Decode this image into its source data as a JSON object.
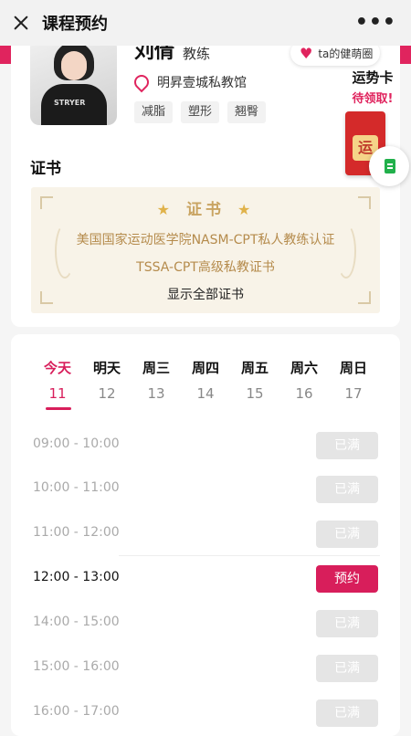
{
  "header": {
    "title": "课程预约",
    "more": "•••"
  },
  "coach": {
    "name": "刘倩",
    "role": "教练",
    "fan_circle": "ta的健萌圈",
    "location": "明昇壹城私教馆",
    "tags": [
      "减脂",
      "塑形",
      "翘臀"
    ]
  },
  "fortune_card": {
    "title": "运势卡",
    "subtitle": "待领取!",
    "char": "运"
  },
  "certificates": {
    "heading": "证书",
    "banner_title": "证书",
    "items": [
      "美国国家运动医学院NASM-CPT私人教练认证",
      "TSSA-CPT高级私教证书"
    ],
    "show_all": "显示全部证书"
  },
  "schedule": {
    "days": [
      {
        "name": "今天",
        "date": "11",
        "active": true
      },
      {
        "name": "明天",
        "date": "12"
      },
      {
        "name": "周三",
        "date": "13"
      },
      {
        "name": "周四",
        "date": "14"
      },
      {
        "name": "周五",
        "date": "15"
      },
      {
        "name": "周六",
        "date": "16"
      },
      {
        "name": "周日",
        "date": "17"
      }
    ],
    "slots": [
      {
        "time": "09:00 - 10:00",
        "status": "已满"
      },
      {
        "time": "10:00 - 11:00",
        "status": "已满"
      },
      {
        "time": "11:00 - 12:00",
        "status": "已满"
      },
      {
        "time": "12:00 - 13:00",
        "status": "预约"
      },
      {
        "time": "14:00 - 15:00",
        "status": "已满"
      },
      {
        "time": "15:00 - 16:00",
        "status": "已满"
      },
      {
        "time": "16:00 - 17:00",
        "status": "已满"
      }
    ]
  },
  "colors": {
    "accent": "#d81e5b",
    "gold": "#c9a462",
    "disabled": "#e5e5e5"
  }
}
